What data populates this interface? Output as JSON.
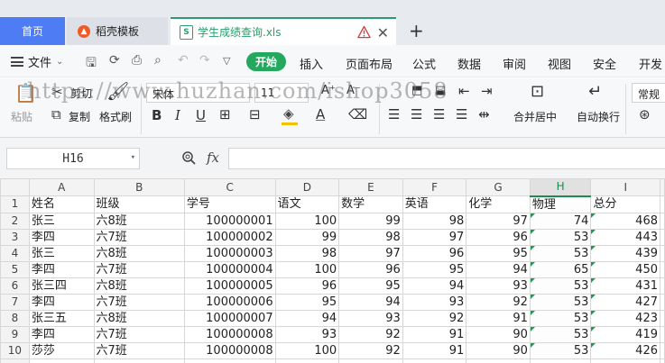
{
  "tabs": {
    "home": "首页",
    "template": "稻壳模板",
    "file": "学生成绩查询.xls"
  },
  "menu": {
    "file": "文件",
    "start": "开始",
    "items": [
      "插入",
      "页面布局",
      "公式",
      "数据",
      "审阅",
      "视图",
      "安全",
      "开发"
    ]
  },
  "ribbon": {
    "paste": "粘贴",
    "cut": "剪切",
    "copy": "复制",
    "format_painter": "格式刷",
    "font_name": "宋体",
    "font_size": "11",
    "merge_center": "合并居中",
    "wrap_text": "自动换行",
    "number_format": "常规"
  },
  "watermark": "https://www.huzhan.com/ishop3058",
  "formula_bar": {
    "cell_ref": "H16",
    "fx": "fx",
    "value": ""
  },
  "sheet": {
    "columns": [
      "A",
      "B",
      "C",
      "D",
      "E",
      "F",
      "G",
      "H",
      "I"
    ],
    "selected_column": "H",
    "row_numbers": [
      "1",
      "2",
      "3",
      "4",
      "5",
      "6",
      "7",
      "8",
      "9",
      "10"
    ],
    "header": [
      "姓名",
      "班级",
      "学号",
      "语文",
      "数学",
      "英语",
      "化学",
      "物理",
      "总分"
    ],
    "rows": [
      [
        "张三",
        "六8班",
        "100000001",
        "100",
        "99",
        "98",
        "97",
        "74",
        "468"
      ],
      [
        "李四",
        "六7班",
        "100000002",
        "99",
        "98",
        "97",
        "96",
        "53",
        "443"
      ],
      [
        "张三",
        "六8班",
        "100000003",
        "98",
        "97",
        "96",
        "95",
        "53",
        "439"
      ],
      [
        "李四",
        "六7班",
        "100000004",
        "100",
        "96",
        "95",
        "94",
        "65",
        "450"
      ],
      [
        "张三四",
        "六8班",
        "100000005",
        "96",
        "95",
        "94",
        "93",
        "53",
        "431"
      ],
      [
        "李四",
        "六7班",
        "100000006",
        "95",
        "94",
        "93",
        "92",
        "53",
        "427"
      ],
      [
        "张三五",
        "六8班",
        "100000007",
        "94",
        "93",
        "92",
        "91",
        "53",
        "423"
      ],
      [
        "李四",
        "六7班",
        "100000008",
        "93",
        "92",
        "91",
        "90",
        "53",
        "419"
      ],
      [
        "莎莎",
        "六7班",
        "100000008",
        "100",
        "92",
        "91",
        "90",
        "53",
        "426"
      ]
    ]
  },
  "colors": {
    "accent_blue": "#4d7cf4",
    "start_green": "#24a85e",
    "file_green": "#2a9d6b",
    "warning_red": "#d33a3a"
  }
}
